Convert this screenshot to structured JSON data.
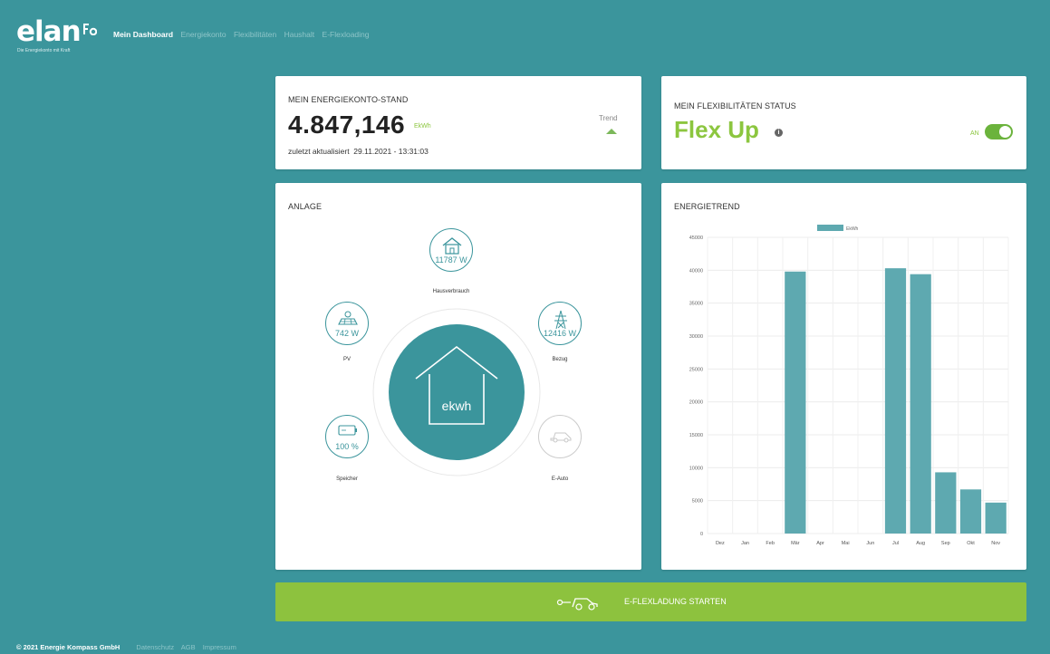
{
  "brand": {
    "logo": "elan",
    "tagline": "Die Energiekonto mit Kraft"
  },
  "nav": {
    "items": [
      "Mein Dashboard",
      "Energiekonto",
      "Flexibilitäten",
      "Haushalt",
      "E-Flexloading"
    ]
  },
  "energy": {
    "title": "MEIN ENERGIEKONTO-STAND",
    "value": "4.847,146",
    "unit": "EkWh",
    "updated_label": "zuletzt aktualisiert",
    "updated_value": "29.11.2021 - 13:31:03",
    "trend_label": "Trend",
    "trend_direction": "up"
  },
  "flex": {
    "title": "MEIN FLEXIBILITÄTEN STATUS",
    "status": "Flex Up",
    "toggle_label": "AN",
    "toggle_on": true
  },
  "anlage": {
    "title": "ANLAGE",
    "hub_label": "ekwh",
    "nodes": {
      "haus": {
        "value": "11787 W",
        "caption": "Hausverbrauch"
      },
      "pv": {
        "value": "742 W",
        "caption": "PV"
      },
      "bezug": {
        "value": "12416 W",
        "caption": "Bezug"
      },
      "speicher": {
        "value": "100 %",
        "caption": "Speicher"
      },
      "eauto": {
        "value": "",
        "caption": "E-Auto"
      }
    }
  },
  "trend": {
    "title": "ENERGIETREND"
  },
  "chart_data": {
    "type": "bar",
    "title": "",
    "legend": "EkWh",
    "legend_position": "top",
    "categories": [
      "Dez",
      "Jan",
      "Feb",
      "Mär",
      "Apr",
      "Mai",
      "Jun",
      "Jul",
      "Aug",
      "Sep",
      "Okt",
      "Nov"
    ],
    "series": [
      {
        "name": "EkWh",
        "values": [
          0,
          0,
          0,
          39800,
          0,
          0,
          0,
          40300,
          39400,
          9300,
          6700,
          4700
        ]
      }
    ],
    "ylim": [
      0,
      45000
    ],
    "yticks": [
      0,
      5000,
      10000,
      15000,
      20000,
      25000,
      30000,
      35000,
      40000,
      45000
    ],
    "grid": true,
    "bar_color": "#5ea9b0"
  },
  "cta": {
    "label": "E-FLEXLADUNG STARTEN"
  },
  "footer": {
    "copyright": "© 2021 Energie Kompass GmbH",
    "links": [
      "Datenschutz",
      "AGB",
      "Impressum"
    ]
  },
  "colors": {
    "background": "#3b959c",
    "accent_green": "#8dc23e",
    "teal": "#3b959c"
  }
}
